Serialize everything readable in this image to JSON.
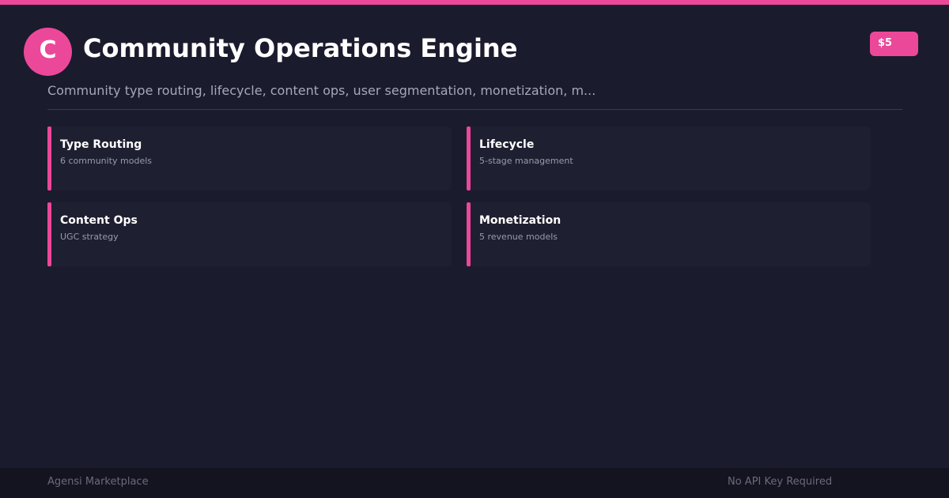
{
  "header": {
    "logo_letter": "C",
    "title": "Community Operations Engine",
    "price": "$5",
    "subtitle": "Community type routing, lifecycle, content ops, user segmentation, monetization, m..."
  },
  "features": [
    {
      "title": "Type Routing",
      "description": "6 community models"
    },
    {
      "title": "Lifecycle",
      "description": "5-stage management"
    },
    {
      "title": "Content Ops",
      "description": "UGC strategy"
    },
    {
      "title": "Monetization",
      "description": "5 revenue models"
    }
  ],
  "footer": {
    "left": "Agensi Marketplace",
    "right": "No API Key Required"
  },
  "colors": {
    "accent": "#ec4899",
    "background": "#1b1b2e",
    "card": "#1f1f32",
    "footer": "#141420"
  }
}
